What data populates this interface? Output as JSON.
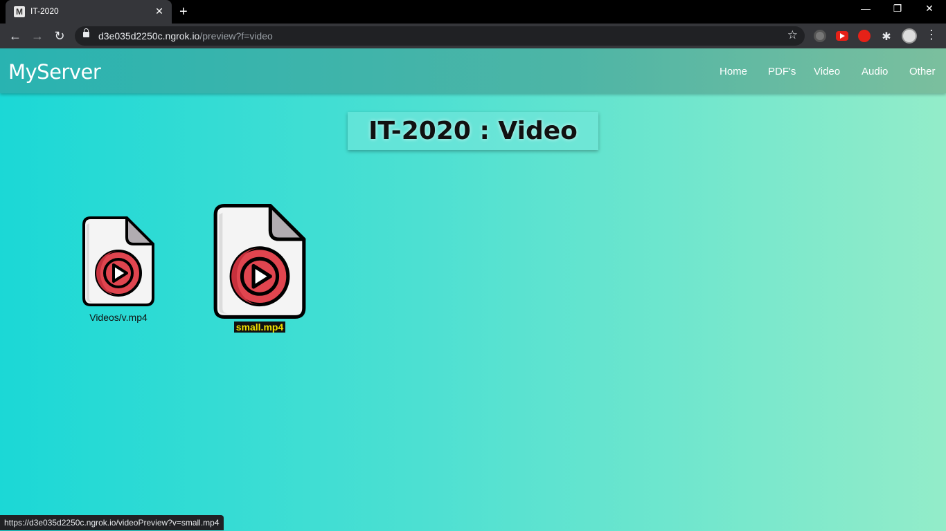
{
  "browser": {
    "tab_title": "IT-2020",
    "tab_favicon": "M",
    "url_host": "d3e035d2250c.ngrok.io",
    "url_path": "/preview?f=video",
    "status_url": "https://d3e035d2250c.ngrok.io/videoPreview?v=small.mp4"
  },
  "site": {
    "brand": "MyServer",
    "nav": [
      "Home",
      "PDF's",
      "Video",
      "Audio",
      "Other"
    ],
    "heading": "IT-2020 : Video"
  },
  "files": [
    {
      "name": "Videos/v.mp4",
      "selected": false
    },
    {
      "name": "small.mp4",
      "selected": true
    }
  ],
  "colors": {
    "play_red": "#e0454f",
    "play_dark_red": "#c7313d",
    "file_body": "#f4f4f4",
    "file_fold": "#b1acb1",
    "highlight_text": "#f3e100"
  }
}
